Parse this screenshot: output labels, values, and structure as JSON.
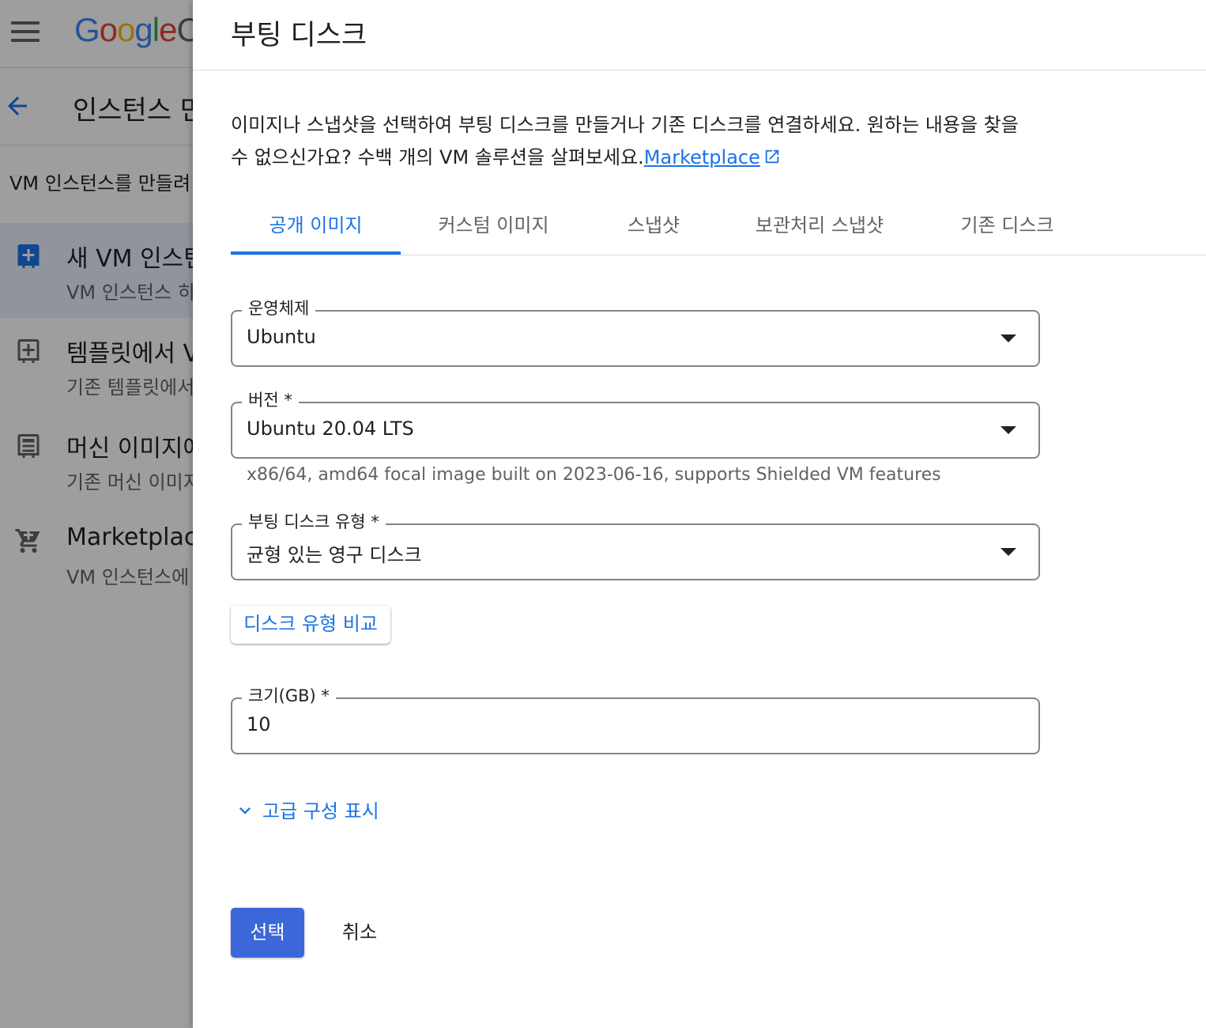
{
  "background": {
    "logo_letters": [
      {
        "ch": "G",
        "color": "#4285f4"
      },
      {
        "ch": "o",
        "color": "#ea4335"
      },
      {
        "ch": "o",
        "color": "#fbbc05"
      },
      {
        "ch": "g",
        "color": "#4285f4"
      },
      {
        "ch": "l",
        "color": "#34a853"
      },
      {
        "ch": "e",
        "color": "#ea4335"
      },
      {
        "ch": " C",
        "color": "#5f6368"
      }
    ],
    "page_title": "인스턴스 만",
    "description": "VM 인스턴스를 만들려",
    "items": [
      {
        "title": "새 VM 인스턴",
        "subtitle": "VM 인스턴스 히",
        "icon": "add-box-icon"
      },
      {
        "title": "템플릿에서 VI",
        "subtitle": "기존 템플릿에서",
        "icon": "add-box-outline-icon"
      },
      {
        "title": "머신 이미지에",
        "subtitle": "기존 머신 이미지",
        "icon": "machine-image-icon"
      },
      {
        "title": "Marketplace",
        "subtitle": "VM 인스턴스에",
        "icon": "cart-icon"
      }
    ]
  },
  "drawer": {
    "title": "부팅 디스크",
    "intro_text": "이미지나 스냅샷을 선택하여 부팅 디스크를 만들거나 기존 디스크를 연결하세요. 원하는 내용을 찾을 수 없으신가요? 수백 개의 VM 솔루션을 살펴보세요.",
    "intro_link": "Marketplace",
    "tabs": [
      {
        "label": "공개 이미지",
        "active": true
      },
      {
        "label": "커스텀 이미지",
        "active": false
      },
      {
        "label": "스냅샷",
        "active": false
      },
      {
        "label": "보관처리 스냅샷",
        "active": false
      },
      {
        "label": "기존 디스크",
        "active": false
      }
    ],
    "os": {
      "label": "운영체제",
      "value": "Ubuntu"
    },
    "version": {
      "label": "버전 *",
      "value": "Ubuntu 20.04 LTS",
      "hint": "x86/64, amd64 focal image built on 2023-06-16, supports Shielded VM features"
    },
    "disk_type": {
      "label": "부팅 디스크 유형 *",
      "value": "균형 있는 영구 디스크"
    },
    "compare_button": "디스크 유형 비교",
    "size": {
      "label": "크기(GB) *",
      "value": "10"
    },
    "advanced_toggle": "고급 구성 표시",
    "select_button": "선택",
    "cancel_button": "취소"
  },
  "colors": {
    "accent": "#1a73e8",
    "primary_button": "#3c67d8"
  }
}
